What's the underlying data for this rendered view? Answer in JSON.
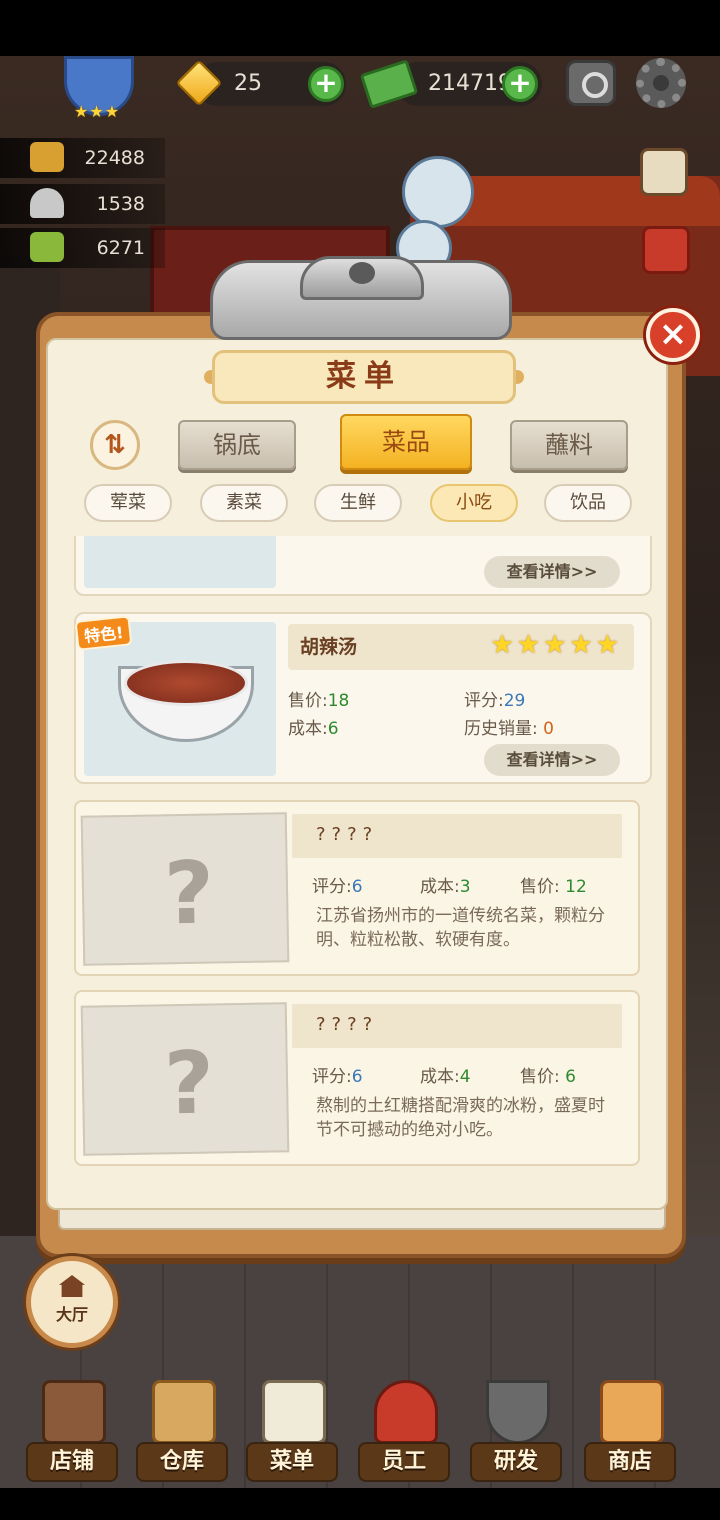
{
  "hud": {
    "gems": "25",
    "cash": "214719",
    "stats": [
      "22488",
      "1538",
      "6271"
    ],
    "badge_stars": "★★★"
  },
  "menu": {
    "title": "菜单",
    "close": "×",
    "sort_icon": "⇅",
    "categories": [
      "锅底",
      "菜品",
      "蘸料"
    ],
    "active_category": "菜品",
    "subcategories": [
      "荤菜",
      "素菜",
      "生鲜",
      "小吃",
      "饮品"
    ],
    "active_subcategory": "小吃",
    "partial_card": {
      "detail": "查看详情>>"
    },
    "featured": {
      "tag": "特色!",
      "name": "胡辣汤",
      "stars": "★★★★★",
      "price_label": "售价:",
      "price": "18",
      "cost_label": "成本:",
      "cost": "6",
      "rating_label": "评分:",
      "rating": "29",
      "sales_label": "历史销量:",
      "sales": "0",
      "detail": "查看详情>>"
    },
    "locked": [
      {
        "name": "????",
        "qmark": "?",
        "rating_label": "评分:",
        "rating": "6",
        "cost_label": "成本:",
        "cost": "3",
        "price_label": "售价:",
        "price": "12",
        "desc": "江苏省扬州市的一道传统名菜，颗粒分明、粒粒松散、软硬有度。"
      },
      {
        "name": "????",
        "qmark": "?",
        "rating_label": "评分:",
        "rating": "6",
        "cost_label": "成本:",
        "cost": "4",
        "price_label": "售价:",
        "price": "6",
        "desc": "熬制的土红糖搭配滑爽的冰粉，盛夏时节不可撼动的绝对小吃。"
      }
    ]
  },
  "hall": {
    "label": "大厅"
  },
  "nav": [
    "店铺",
    "仓库",
    "菜单",
    "员工",
    "研发",
    "商店"
  ],
  "colors": {
    "accent": "#f4b222",
    "title": "#8a3c18",
    "close": "#d8402a",
    "green": "#2e8a2e",
    "blue": "#3a78b8"
  }
}
